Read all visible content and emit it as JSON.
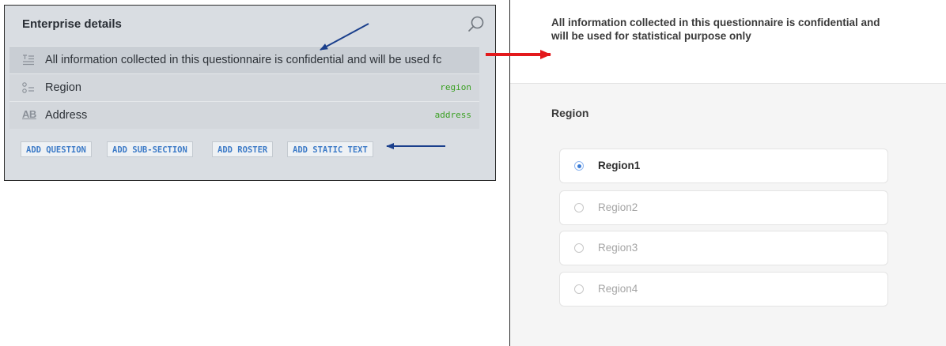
{
  "designer": {
    "title": "Enterprise details",
    "rows": [
      {
        "icon": "static-text-icon",
        "label": "All information collected in this questionnaire is confidential and will be used fc",
        "variable": ""
      },
      {
        "icon": "single-select-icon",
        "label": "Region",
        "variable": "region"
      },
      {
        "icon": "text-question-icon",
        "icon_text": "AB",
        "label": "Address",
        "variable": "address"
      }
    ],
    "buttons": [
      "ADD QUESTION",
      "ADD SUB-SECTION",
      "ADD ROSTER",
      "ADD STATIC TEXT"
    ]
  },
  "preview": {
    "static_text": "All information collected in this questionnaire is confidential and will be used for statistical purpose only",
    "question_title": "Region",
    "options": [
      {
        "label": "Region1",
        "selected": true
      },
      {
        "label": "Region2",
        "selected": false
      },
      {
        "label": "Region3",
        "selected": false
      },
      {
        "label": "Region4",
        "selected": false
      }
    ]
  },
  "colors": {
    "annotation_blue": "#1a3f8c",
    "annotation_red": "#e3191c",
    "button_text": "#3d7bc7",
    "variable_text": "#3aa022"
  }
}
